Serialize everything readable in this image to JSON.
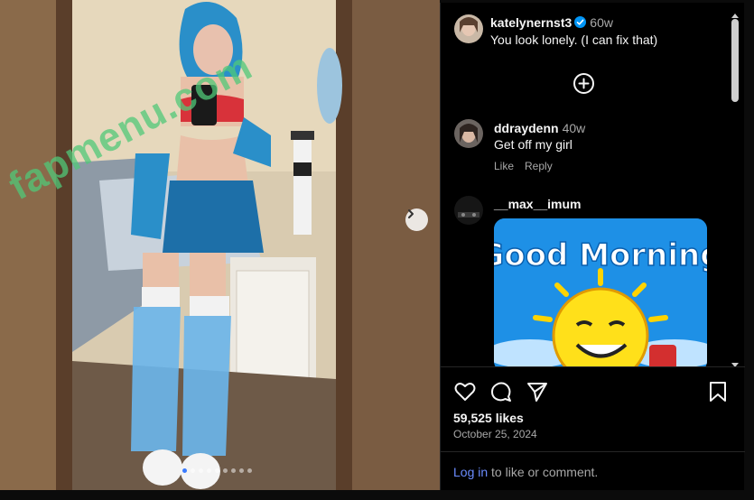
{
  "post": {
    "watermark": "fapmenu.com",
    "slide_count": 9,
    "active_slide": 1
  },
  "caption": {
    "username": "katelynernst3",
    "time": "60w",
    "text": "You look lonely. (I can fix that)",
    "verified": true
  },
  "comments": [
    {
      "username": "ddraydenn",
      "time": "40w",
      "text": "Get off my girl",
      "like_label": "Like",
      "reply_label": "Reply"
    },
    {
      "username": "__max__imum",
      "time": "",
      "gif_text": "Good Morning"
    }
  ],
  "stats": {
    "likes": "59,525 likes",
    "date": "October 25, 2024"
  },
  "footer": {
    "login_link": "Log in",
    "login_text": " to like or comment."
  },
  "colors": {
    "accent": "#0095f6",
    "link": "#6b8cff",
    "background": "#000000"
  },
  "icons": [
    "heart-icon",
    "comment-icon",
    "share-icon",
    "bookmark-icon",
    "add-circle-icon",
    "chevron-right-icon",
    "verified-icon"
  ]
}
